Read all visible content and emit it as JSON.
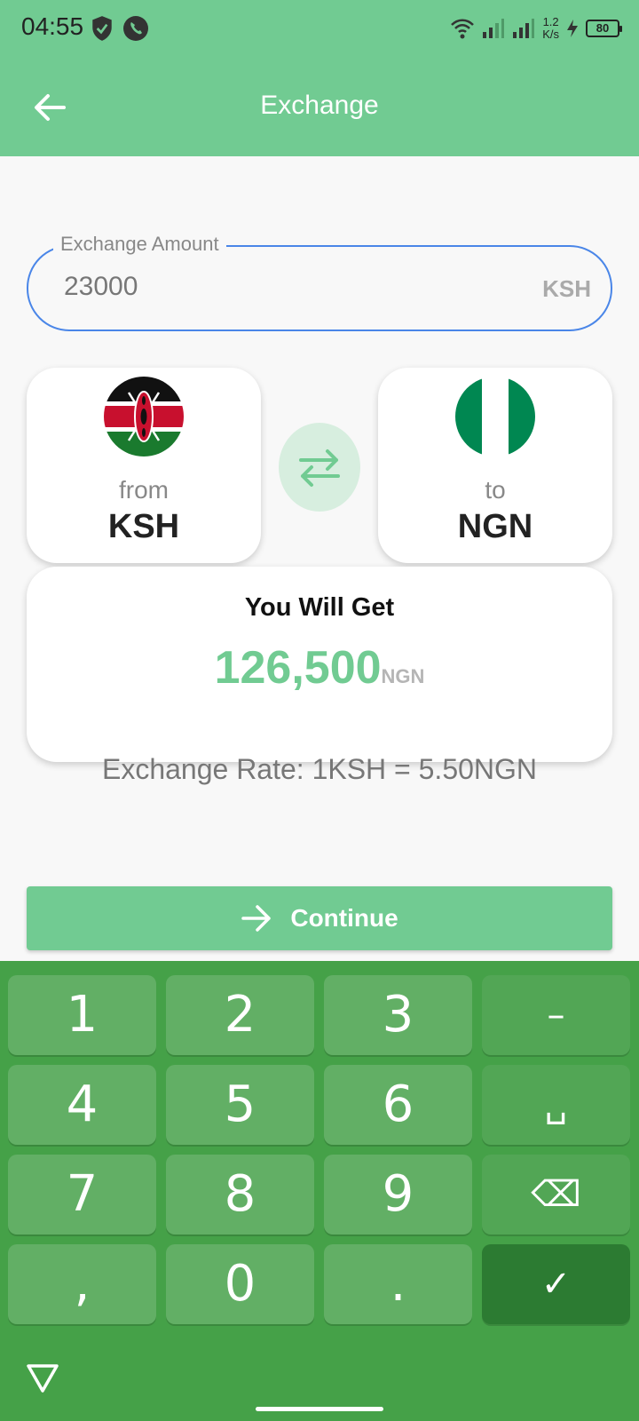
{
  "status_bar": {
    "time": "04:55",
    "speed_top": "1.2",
    "speed_bottom": "K/s",
    "battery": "80"
  },
  "app_bar": {
    "title": "Exchange"
  },
  "amount_field": {
    "label": "Exchange Amount",
    "value": "23000",
    "unit": "KSH"
  },
  "from_card": {
    "sub": "from",
    "code": "KSH",
    "flag_icon": "kenya-flag-icon"
  },
  "to_card": {
    "sub": "to",
    "code": "NGN",
    "flag_icon": "nigeria-flag-icon"
  },
  "result": {
    "title": "You Will Get",
    "value": "126,500",
    "unit": "NGN"
  },
  "rate": {
    "text": "Exchange Rate: 1KSH = 5.50NGN"
  },
  "continue_button": {
    "label": "Continue"
  },
  "keyboard": {
    "rows": [
      [
        "1",
        "2",
        "3",
        "–"
      ],
      [
        "4",
        "5",
        "6",
        "␣"
      ],
      [
        "7",
        "8",
        "9",
        "⌫"
      ],
      [
        ",",
        "0",
        ".",
        "✓"
      ]
    ]
  },
  "colors": {
    "accent": "#71cb92",
    "keyboard_bg": "#45a148",
    "key_bg": "#62af65",
    "done_key": "#2c7b32"
  }
}
